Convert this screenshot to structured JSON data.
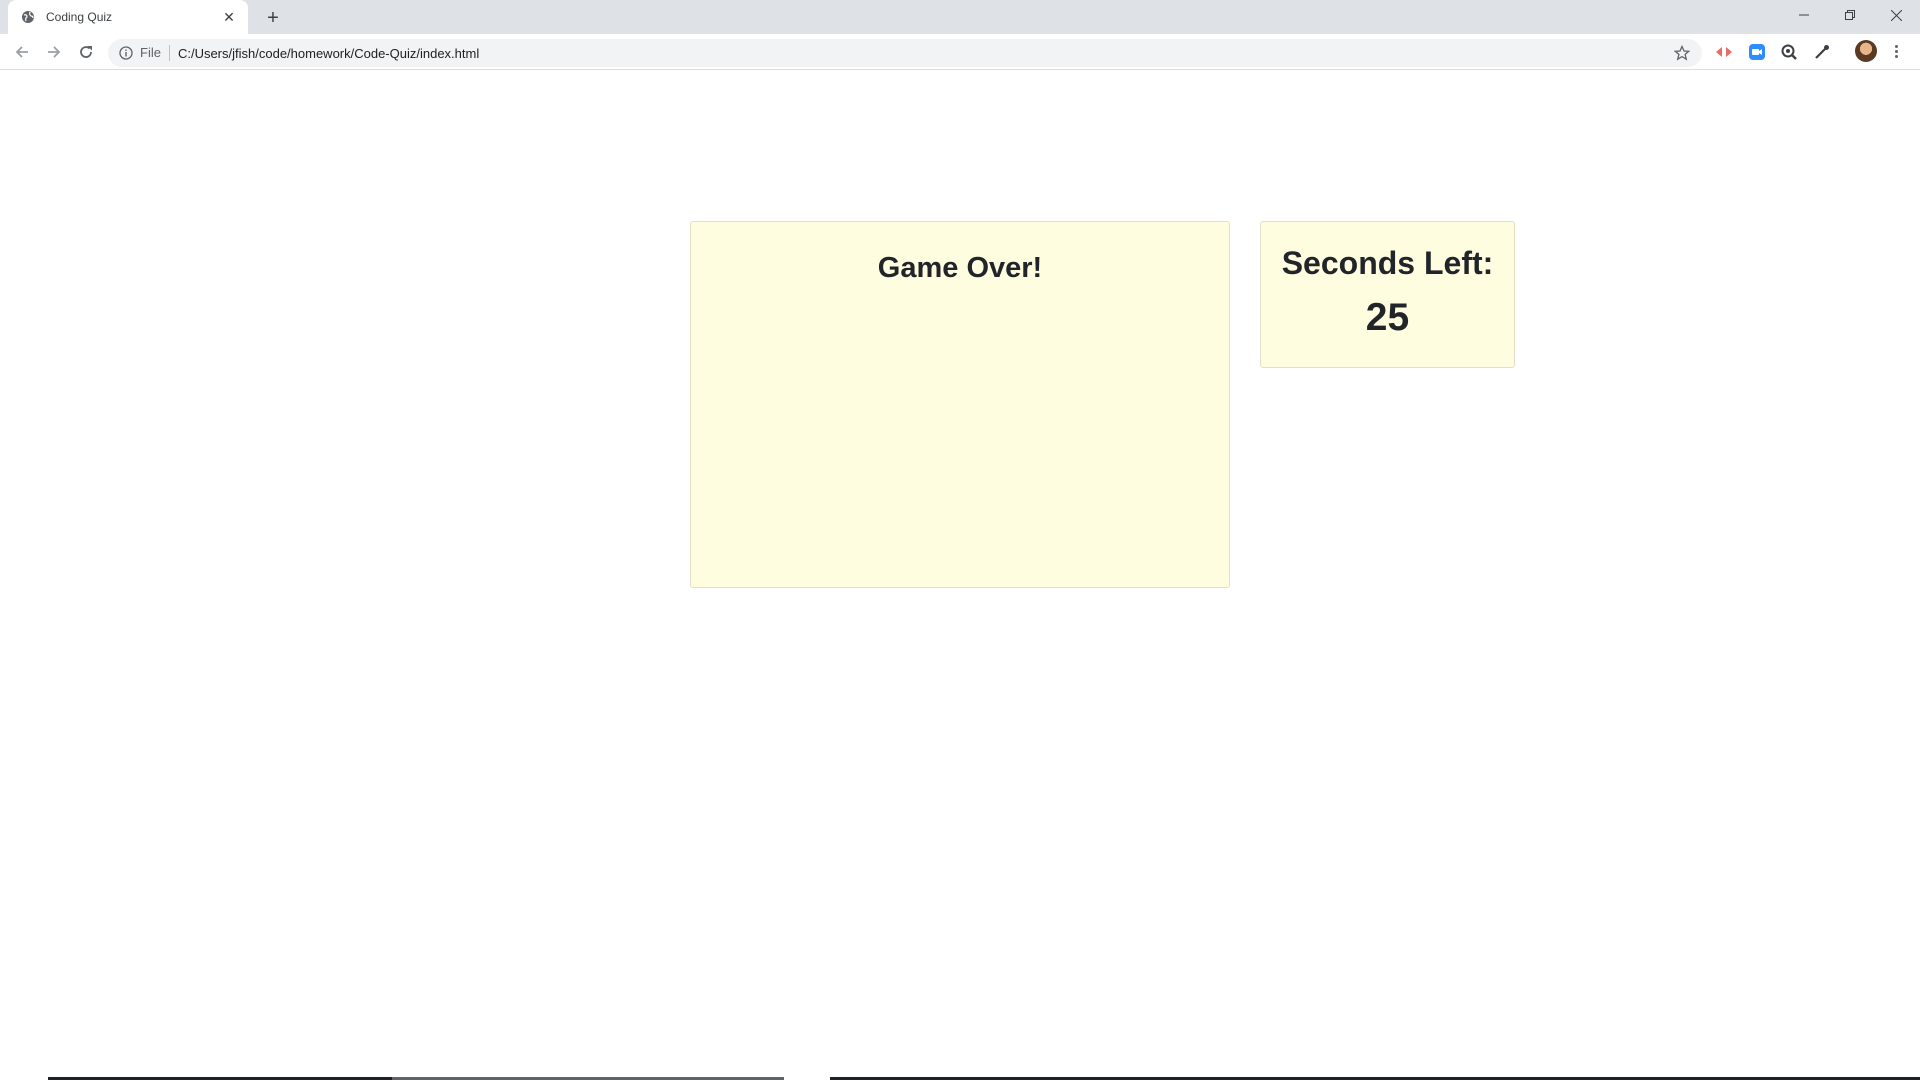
{
  "browser": {
    "tab": {
      "title": "Coding Quiz",
      "favicon": "globe-icon",
      "close_icon": "close-icon"
    },
    "new_tab_icon": "plus-icon",
    "window_controls": [
      "minimize-icon",
      "restore-icon",
      "close-icon"
    ],
    "address_bar": {
      "scheme_label": "File",
      "url": "C:/Users/jfish/code/homework/Code-Quiz/index.html"
    }
  },
  "quiz": {
    "heading": "Game Over!"
  },
  "timer": {
    "label": "Seconds Left:",
    "value": "25"
  },
  "colors": {
    "card_background": "#fffddf",
    "card_border": "#e2e0c8",
    "text": "#212529"
  }
}
